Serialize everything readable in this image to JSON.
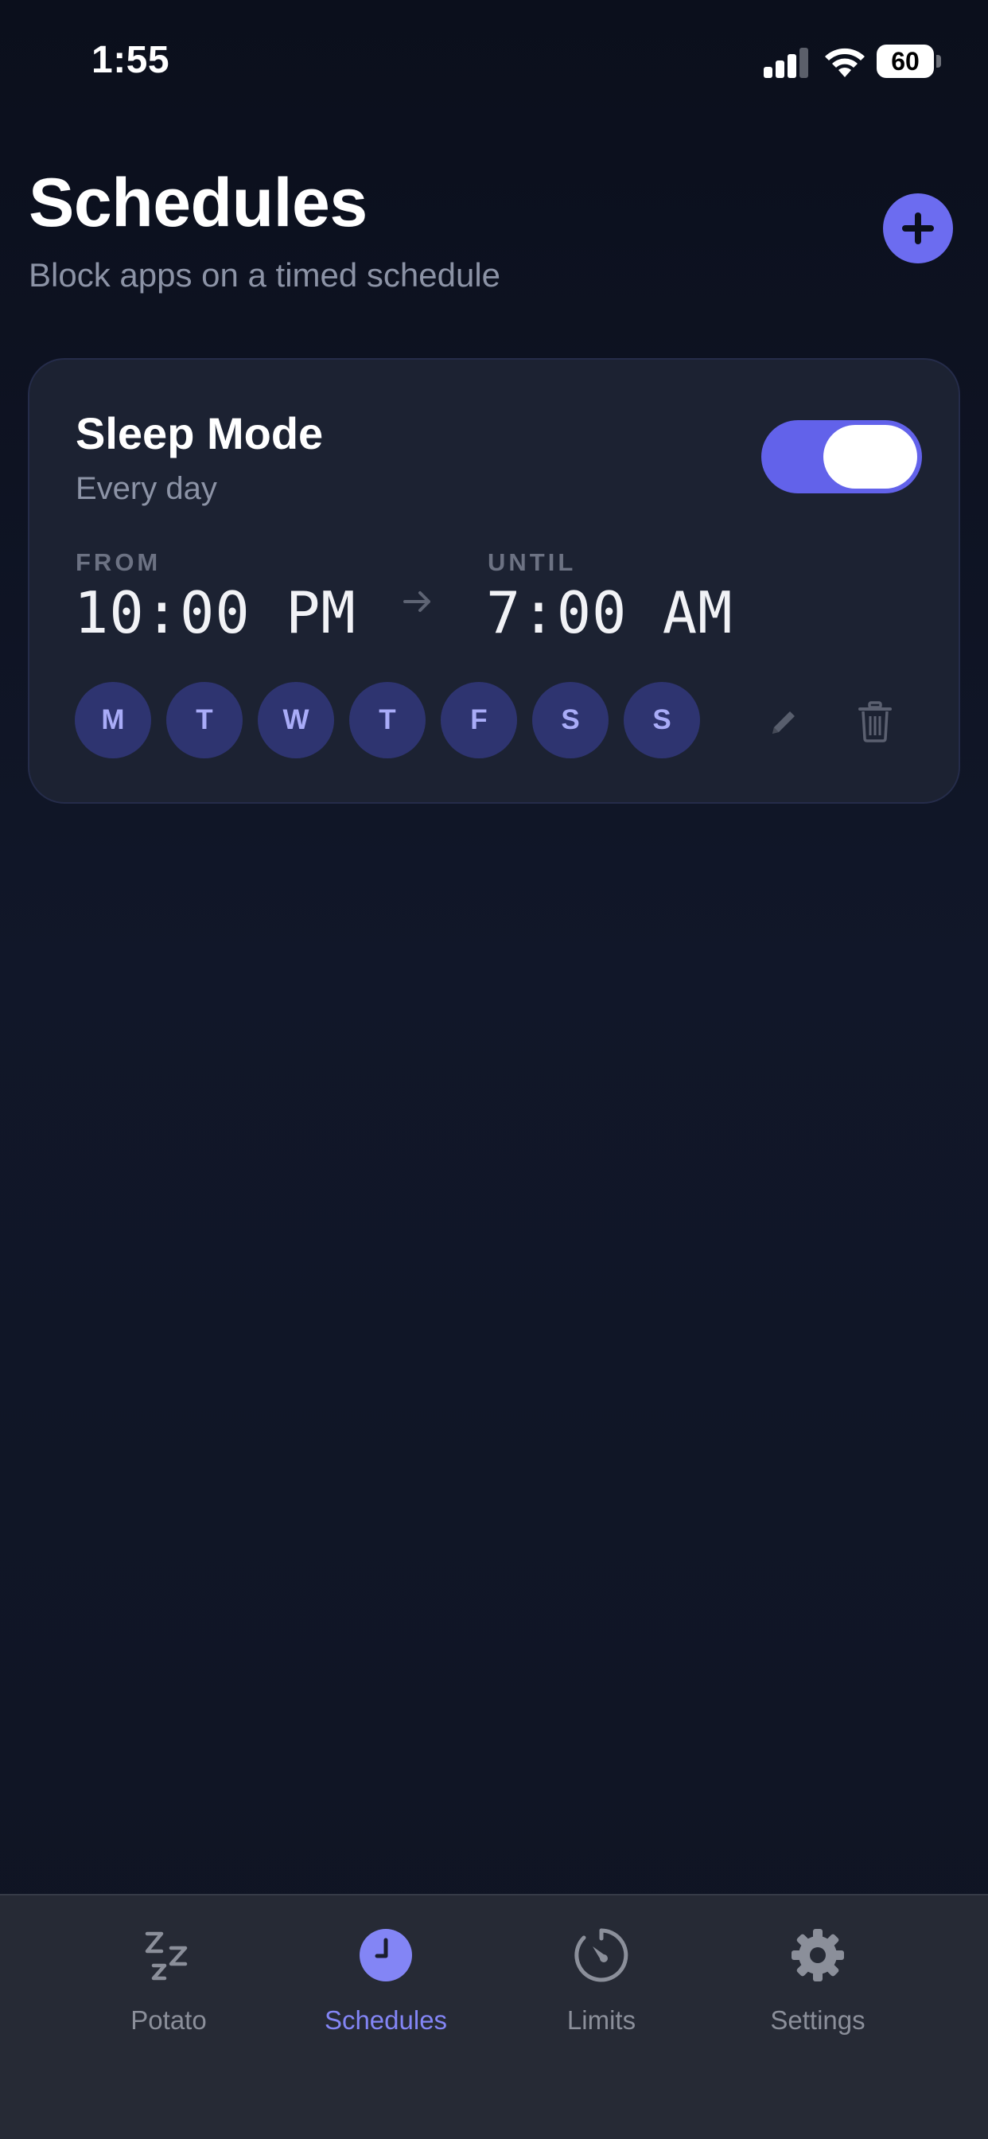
{
  "status_bar": {
    "time": "1:55",
    "battery": "60"
  },
  "header": {
    "title": "Schedules",
    "subtitle": "Block apps on a timed schedule"
  },
  "schedule": {
    "name": "Sleep Mode",
    "frequency": "Every day",
    "enabled": true,
    "from_label": "FROM",
    "from_time": "10:00 PM",
    "until_label": "UNTIL",
    "until_time": "7:00 AM",
    "days": [
      "M",
      "T",
      "W",
      "T",
      "F",
      "S",
      "S"
    ]
  },
  "tabs": [
    {
      "label": "Potato",
      "icon": "zzz-icon",
      "active": false
    },
    {
      "label": "Schedules",
      "icon": "clock-icon",
      "active": true
    },
    {
      "label": "Limits",
      "icon": "timer-icon",
      "active": false
    },
    {
      "label": "Settings",
      "icon": "gear-icon",
      "active": false
    }
  ],
  "colors": {
    "accent": "#6c6cf0",
    "day_chip": "#2e3470",
    "card": "#1c2232",
    "tab_bar": "#262a35"
  }
}
